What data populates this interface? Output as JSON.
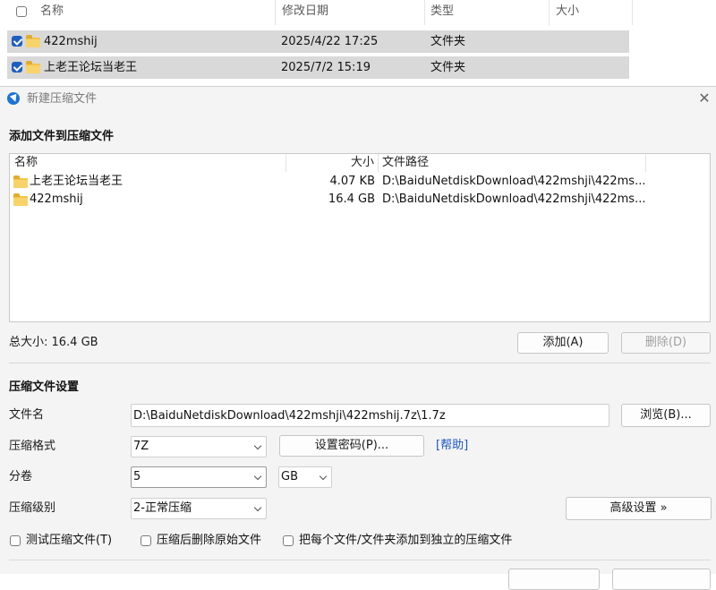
{
  "explorer": {
    "columns": {
      "name": "名称",
      "modified": "修改日期",
      "type": "类型",
      "size": "大小"
    },
    "sort_indicator": "^",
    "rows": [
      {
        "name": "422mshij",
        "modified": "2025/4/22 17:25",
        "type": "文件夹",
        "checked": true
      },
      {
        "name": "上老王论坛当老王",
        "modified": "2025/7/2 15:19",
        "type": "文件夹",
        "checked": true
      }
    ]
  },
  "dialog": {
    "title": "新建压缩文件",
    "close_symbol": "✕",
    "add_section": {
      "title": "添加文件到压缩文件",
      "columns": {
        "name": "名称",
        "size": "大小",
        "path": "文件路径"
      },
      "items": [
        {
          "name": "上老王论坛当老王",
          "size": "4.07 KB",
          "path": "D:\\BaiduNetdiskDownload\\422mshji\\422ms..."
        },
        {
          "name": "422mshij",
          "size": "16.4 GB",
          "path": "D:\\BaiduNetdiskDownload\\422mshji\\422ms..."
        }
      ],
      "total_size": "总大小: 16.4 GB",
      "add_button": "添加(A)",
      "delete_button": "删除(D)"
    },
    "settings": {
      "title": "压缩文件设置",
      "filename_label": "文件名",
      "filename_value": "D:\\BaiduNetdiskDownload\\422mshji\\422mshij.7z\\1.7z",
      "browse_button": "浏览(B)...",
      "format_label": "压缩格式",
      "format_value": "7Z",
      "password_button": "设置密码(P)...",
      "help_link": "[帮助]",
      "split_label": "分卷",
      "split_value": "5",
      "split_unit": "GB",
      "level_label": "压缩级别",
      "level_value": "2-正常压缩",
      "advanced_button": "高级设置 »",
      "options": {
        "test": "测试压缩文件(T)",
        "delete_after": "压缩后删除原始文件",
        "each_separate": "把每个文件/文件夹添加到独立的压缩文件"
      }
    }
  },
  "colors": {
    "accent": "#1f5fbf",
    "row_selected": "#d9d9d9",
    "dialog_bg": "#f4f4f4",
    "link": "#1d54c7",
    "folder": "#f3c54a"
  }
}
